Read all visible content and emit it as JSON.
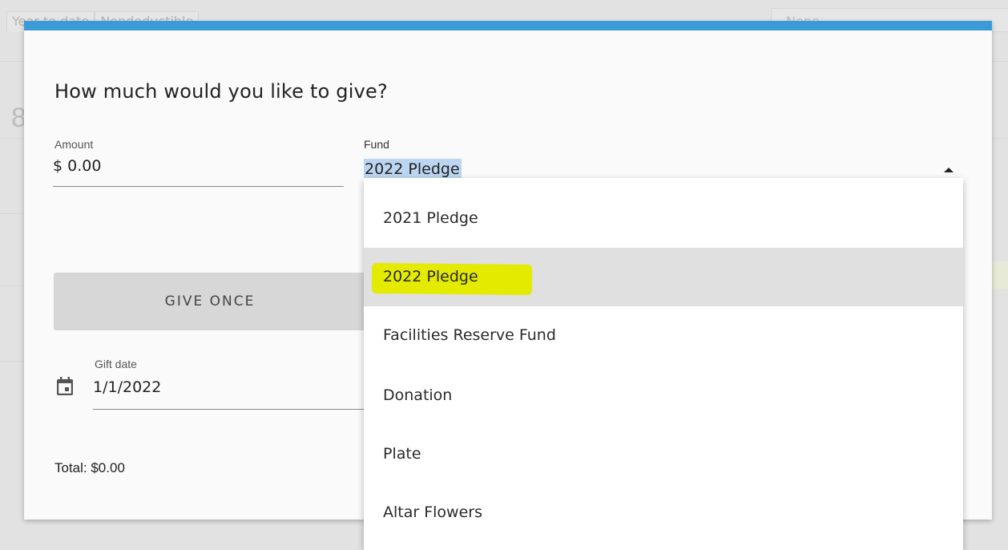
{
  "background": {
    "tabs": [
      "Year to date",
      "Nondeductible"
    ],
    "right_box": "None",
    "left_digit": "8"
  },
  "modal": {
    "accent_color": "#3b9bd6",
    "title": "How much would you like to give?",
    "amount": {
      "label": "Amount",
      "value": "$ 0.00"
    },
    "fund": {
      "label": "Fund",
      "value": "2022 Pledge",
      "expanded": true
    },
    "give_once_label": "GIVE ONCE",
    "gift_date": {
      "icon": "calendar-icon",
      "label": "Gift date",
      "value": "1/1/2022"
    },
    "total": "Total: $0.00"
  },
  "dropdown": {
    "options": [
      {
        "label": "2021 Pledge"
      },
      {
        "label": "2022 Pledge",
        "selected": true,
        "highlight_color": "#e4ea00"
      },
      {
        "label": "Facilities Reserve Fund"
      },
      {
        "label": "Donation"
      },
      {
        "label": "Plate"
      },
      {
        "label": "Altar Flowers"
      }
    ]
  }
}
